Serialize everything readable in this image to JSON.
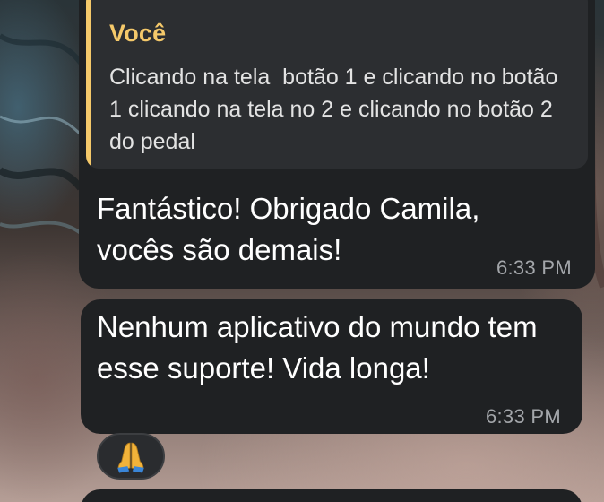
{
  "reply_quote": {
    "author": "Você",
    "text": "Clicando na tela  botão 1 e clicando no botão 1 clicando na tela no 2 e clicando no botão 2 do pedal"
  },
  "messages": [
    {
      "text": "Fantástico! Obrigado Camila, vocês são demais!",
      "time": "6:33 PM"
    },
    {
      "text": "Nenhum aplicativo do mundo tem esse suporte! Vida longa!",
      "time": "6:33 PM"
    }
  ],
  "reaction": {
    "icon": "praying-hands-icon"
  },
  "colors": {
    "bubble": "#1f2123",
    "quote_background": "#2c2e31",
    "quote_accent": "#f5c96a",
    "timestamp": "#a3a6aa"
  }
}
